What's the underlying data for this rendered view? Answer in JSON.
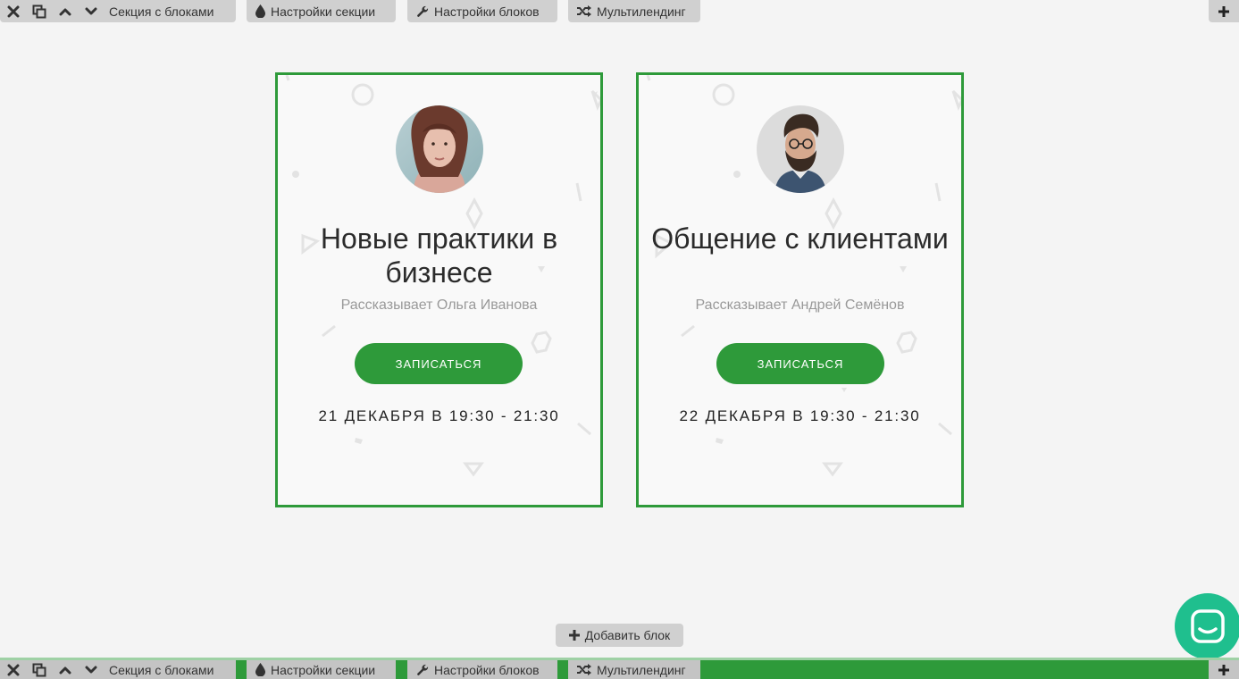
{
  "toolbar": {
    "icons": [
      "close-icon",
      "duplicate-icon",
      "chevron-up-icon",
      "chevron-down-icon"
    ],
    "section_label": "Секция с блоками",
    "section_settings": "Настройки секции",
    "block_settings": "Настройки блоков",
    "multilanding": "Мультилендинг",
    "add_section_icon": "plus-icon"
  },
  "cards": [
    {
      "title": "Новые практики в бизнесе",
      "speaker": "Рассказывает Ольга Иванова",
      "button": "ЗАПИСАТЬСЯ",
      "date": "21 ДЕКАБРЯ В 19:30 - 21:30"
    },
    {
      "title": "Общение с клиентами",
      "speaker": "Рассказывает Андрей Семёнов",
      "button": "ЗАПИСАТЬСЯ",
      "date": "22 ДЕКАБРЯ В 19:30 - 21:30"
    }
  ],
  "add_block": {
    "label": "Добавить блок"
  },
  "colors": {
    "accent": "#2e9a3a",
    "chat": "#1fbf8e",
    "toolbar": "#d0d0d0",
    "background": "#f4f4f4"
  }
}
